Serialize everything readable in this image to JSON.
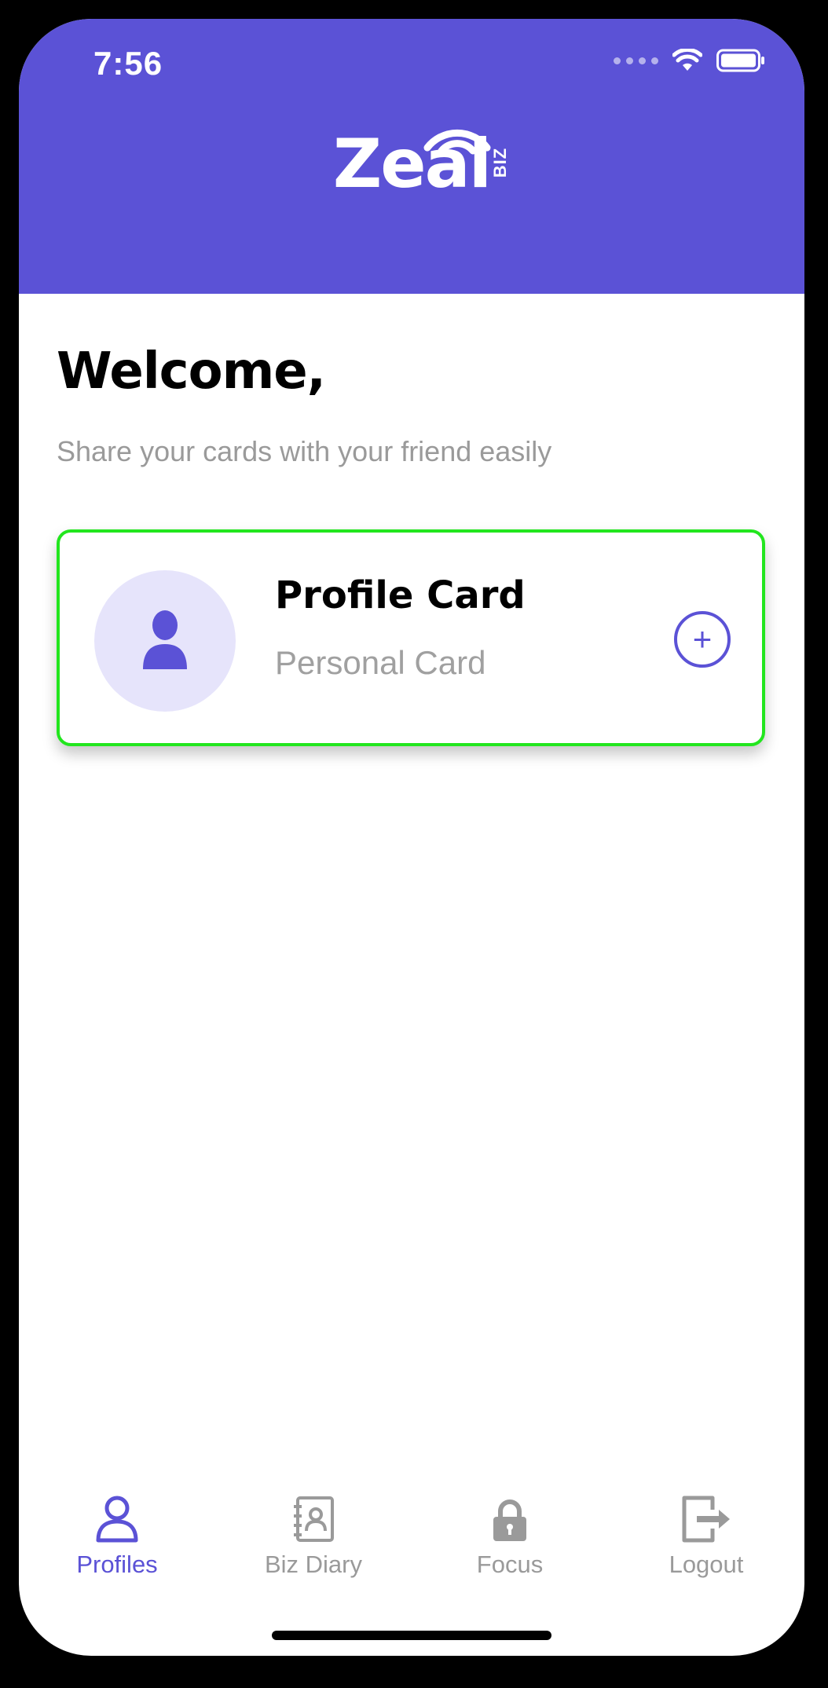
{
  "status_bar": {
    "time": "7:56",
    "icons": [
      "signal-dots-icon",
      "wifi-icon",
      "battery-icon"
    ]
  },
  "header": {
    "logo_text": "Zeal",
    "logo_suffix": "BIZ",
    "background_color": "#5b52d6"
  },
  "main": {
    "welcome_title": "Welcome,",
    "subtitle": "Share your cards with your friend easily"
  },
  "profile_card": {
    "title": "Profile Card",
    "subtitle": "Personal Card",
    "avatar_icon": "person-icon",
    "action_icon": "plus-circle-icon",
    "action_label": "+",
    "highlight_color": "#22e61e"
  },
  "tabbar": {
    "tabs": [
      {
        "label": "Profiles",
        "icon": "person-outline-icon",
        "active": true
      },
      {
        "label": "Biz Diary",
        "icon": "contact-book-icon",
        "active": false
      },
      {
        "label": "Focus",
        "icon": "lock-icon",
        "active": false
      },
      {
        "label": "Logout",
        "icon": "logout-icon",
        "active": false
      }
    ],
    "active_color": "#5b52d6",
    "inactive_color": "#9a9a9a"
  }
}
